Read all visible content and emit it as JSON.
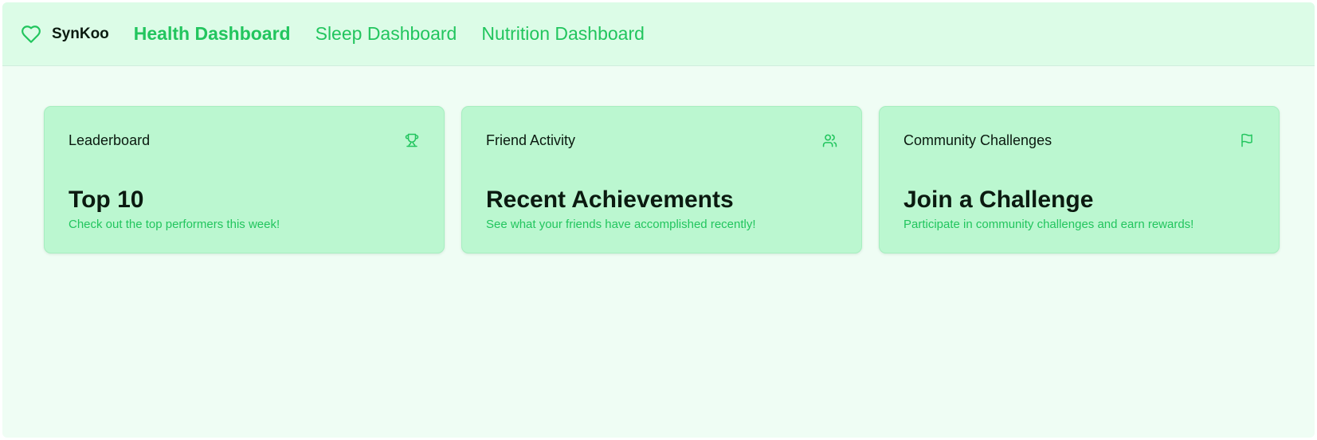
{
  "colors": {
    "accent": "#22c55e",
    "nav_background": "#dcfce7",
    "page_background": "#effdf4",
    "card_background": "#bbf7d0",
    "text_dark": "#0b1a10"
  },
  "header": {
    "brand": {
      "icon": "heart-icon",
      "name": "SynKoo"
    },
    "nav": [
      {
        "label": "Health Dashboard",
        "active": true
      },
      {
        "label": "Sleep Dashboard",
        "active": false
      },
      {
        "label": "Nutrition Dashboard",
        "active": false
      }
    ]
  },
  "cards": [
    {
      "label": "Leaderboard",
      "icon": "trophy-icon",
      "title": "Top 10",
      "subtitle": "Check out the top performers this week!"
    },
    {
      "label": "Friend Activity",
      "icon": "users-icon",
      "title": "Recent Achievements",
      "subtitle": "See what your friends have accomplished recently!"
    },
    {
      "label": "Community Challenges",
      "icon": "flag-icon",
      "title": "Join a Challenge",
      "subtitle": "Participate in community challenges and earn rewards!"
    }
  ]
}
